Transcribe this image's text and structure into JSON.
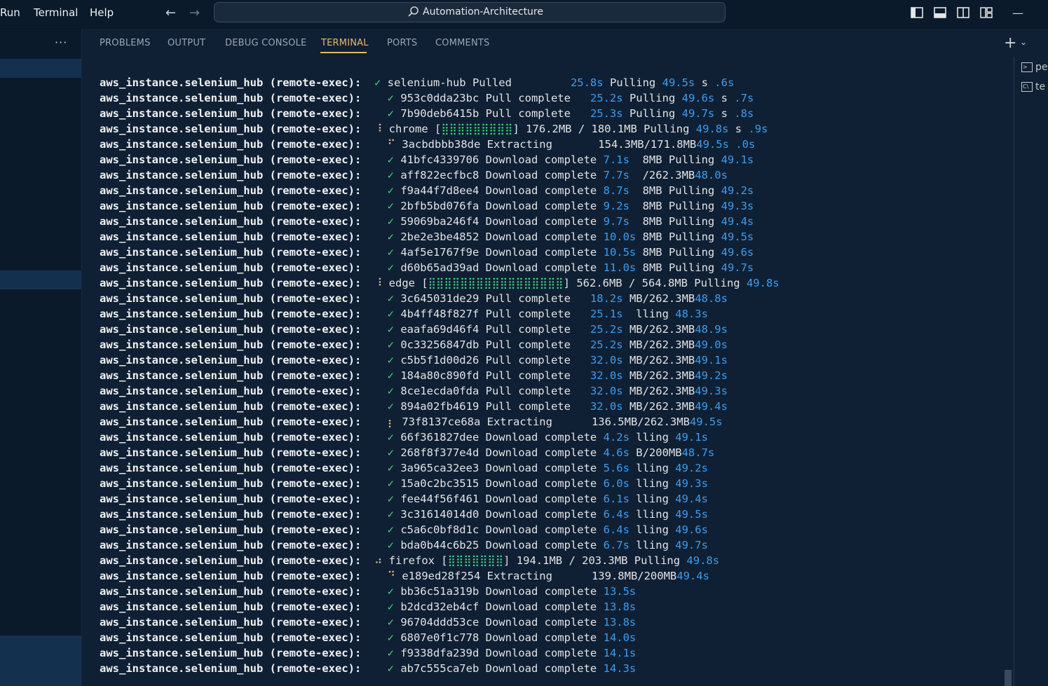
{
  "menu": {
    "run": "Run",
    "terminal": "Terminal",
    "help": "Help"
  },
  "nav": {
    "back": "←",
    "forward": "→"
  },
  "search": {
    "text": "Automation-Architecture"
  },
  "window": {
    "minimize": "—"
  },
  "sidebar": {
    "more": "···"
  },
  "panel_tabs": [
    "PROBLEMS",
    "OUTPUT",
    "DEBUG CONSOLE",
    "TERMINAL",
    "PORTS",
    "COMMENTS"
  ],
  "panel_actions": {
    "new_terminal": "+",
    "dropdown": "⌄"
  },
  "terminal_list": [
    "pe",
    "te"
  ],
  "prefix": "aws_instance.selenium_hub (remote-exec):",
  "lines": [
    {
      "indent": "",
      "mark": "✓",
      "kind": "check",
      "text": "selenium-hub Pulled         ",
      "b1": "25.8s",
      "mid": " Pulling ",
      "b2": "49.5s",
      "tail": " s ",
      "b3": ".6s"
    },
    {
      "indent": "  ",
      "mark": "✓",
      "kind": "check",
      "text": "953c0dda23bc Pull complete   ",
      "b1": "25.2s",
      "mid": " Pulling ",
      "b2": "49.6s",
      "tail": " s ",
      "b3": ".7s"
    },
    {
      "indent": "  ",
      "mark": "✓",
      "kind": "check",
      "text": "7b90deb6415b Pull complete   ",
      "b1": "25.3s",
      "mid": " Pulling ",
      "b2": "49.7s",
      "tail": " s ",
      "b3": ".8s"
    },
    {
      "indent": "",
      "mark": "⠸",
      "kind": "spin",
      "text": "chrome [",
      "bar": "⣿⣿⣿⣿⣿⣿⣿⣿⣿",
      "text2": "] 176.2MB / 180.1MB Pulling ",
      "b2": "49.8s",
      "tail": " s ",
      "b3": ".9s"
    },
    {
      "indent": "  ",
      "mark": "⠋",
      "kind": "spin",
      "text": "3acbdbbb38de Extracting       154.3MB/171.8MB",
      "b2": "49.5s",
      "tail": " ",
      "b3": ".0s"
    },
    {
      "indent": "  ",
      "mark": "✓",
      "kind": "check",
      "text": "41bfc4339706 Download complete ",
      "b1": "7.1s",
      "mid": "  8MB Pulling ",
      "b2": "49.1s"
    },
    {
      "indent": "  ",
      "mark": "✓",
      "kind": "check",
      "text": "aff822ecfbc8 Download complete ",
      "b1": "7.7s",
      "mid": "  /262.3MB",
      "b2": "48.0s"
    },
    {
      "indent": "  ",
      "mark": "✓",
      "kind": "check",
      "text": "f9a44f7d8ee4 Download complete ",
      "b1": "8.7s",
      "mid": "  8MB Pulling ",
      "b2": "49.2s"
    },
    {
      "indent": "  ",
      "mark": "✓",
      "kind": "check",
      "text": "2bfb5bd076fa Download complete ",
      "b1": "9.2s",
      "mid": "  8MB Pulling ",
      "b2": "49.3s"
    },
    {
      "indent": "  ",
      "mark": "✓",
      "kind": "check",
      "text": "59069ba246f4 Download complete ",
      "b1": "9.7s",
      "mid": "  8MB Pulling ",
      "b2": "49.4s"
    },
    {
      "indent": "  ",
      "mark": "✓",
      "kind": "check",
      "text": "2be2e3be4852 Download complete ",
      "b1": "10.0s",
      "mid": " 8MB Pulling ",
      "b2": "49.5s"
    },
    {
      "indent": "  ",
      "mark": "✓",
      "kind": "check",
      "text": "4af5e1767f9e Download complete ",
      "b1": "10.5s",
      "mid": " 8MB Pulling ",
      "b2": "49.6s"
    },
    {
      "indent": "  ",
      "mark": "✓",
      "kind": "check",
      "text": "d60b65ad39ad Download complete ",
      "b1": "11.0s",
      "mid": " 8MB Pulling ",
      "b2": "49.7s"
    },
    {
      "indent": "",
      "mark": "⠸",
      "kind": "spin",
      "text": "edge [",
      "bar": "⣿⣿⣿⣿⣿⣿⣿⣿⣿⣿⣿⣿⣿⣿⣿⣿⣿",
      "text2": "] 562.6MB / 564.8MB Pulling ",
      "b2": "49.8s"
    },
    {
      "indent": "  ",
      "mark": "✓",
      "kind": "check",
      "text": "3c645031de29 Pull complete   ",
      "b1": "18.2s",
      "mid": " MB/262.3MB",
      "b2": "48.8s"
    },
    {
      "indent": "  ",
      "mark": "✓",
      "kind": "check",
      "text": "4b4ff48f827f Pull complete   ",
      "b1": "25.1s",
      "mid": "  lling ",
      "b2": "48.3s"
    },
    {
      "indent": "  ",
      "mark": "✓",
      "kind": "check",
      "text": "eaafa69d46f4 Pull complete   ",
      "b1": "25.2s",
      "mid": " MB/262.3MB",
      "b2": "48.9s"
    },
    {
      "indent": "  ",
      "mark": "✓",
      "kind": "check",
      "text": "0c33256847db Pull complete   ",
      "b1": "25.2s",
      "mid": " MB/262.3MB",
      "b2": "49.0s"
    },
    {
      "indent": "  ",
      "mark": "✓",
      "kind": "check",
      "text": "c5b5f1d00d26 Pull complete   ",
      "b1": "32.0s",
      "mid": " MB/262.3MB",
      "b2": "49.1s"
    },
    {
      "indent": "  ",
      "mark": "✓",
      "kind": "check",
      "text": "184a80c890fd Pull complete   ",
      "b1": "32.0s",
      "mid": " MB/262.3MB",
      "b2": "49.2s"
    },
    {
      "indent": "  ",
      "mark": "✓",
      "kind": "check",
      "text": "8ce1ecda0fda Pull complete   ",
      "b1": "32.0s",
      "mid": " MB/262.3MB",
      "b2": "49.3s"
    },
    {
      "indent": "  ",
      "mark": "✓",
      "kind": "check",
      "text": "894a02fb4619 Pull complete   ",
      "b1": "32.0s",
      "mid": " MB/262.3MB",
      "b2": "49.4s"
    },
    {
      "indent": "  ",
      "mark": "⡆",
      "kind": "spin",
      "text": "73f8137ce68a Extracting      136.5MB/262.3MB",
      "b2": "49.5s"
    },
    {
      "indent": "  ",
      "mark": "✓",
      "kind": "check",
      "text": "66f361827dee Download complete ",
      "b1": "4.2s",
      "mid": " lling ",
      "b2": "49.1s"
    },
    {
      "indent": "  ",
      "mark": "✓",
      "kind": "check",
      "text": "268f8f377e4d Download complete ",
      "b1": "4.6s",
      "mid": " B/200MB",
      "b2": "48.7s"
    },
    {
      "indent": "  ",
      "mark": "✓",
      "kind": "check",
      "text": "3a965ca32ee3 Download complete ",
      "b1": "5.6s",
      "mid": " lling ",
      "b2": "49.2s"
    },
    {
      "indent": "  ",
      "mark": "✓",
      "kind": "check",
      "text": "15a0c2bc3515 Download complete ",
      "b1": "6.0s",
      "mid": " lling ",
      "b2": "49.3s"
    },
    {
      "indent": "  ",
      "mark": "✓",
      "kind": "check",
      "text": "fee44f56f461 Download complete ",
      "b1": "6.1s",
      "mid": " lling ",
      "b2": "49.4s"
    },
    {
      "indent": "  ",
      "mark": "✓",
      "kind": "check",
      "text": "3c31614014d0 Download complete ",
      "b1": "6.4s",
      "mid": " lling ",
      "b2": "49.5s"
    },
    {
      "indent": "  ",
      "mark": "✓",
      "kind": "check",
      "text": "c5a6c0bf8d1c Download complete ",
      "b1": "6.4s",
      "mid": " lling ",
      "b2": "49.6s"
    },
    {
      "indent": "  ",
      "mark": "✓",
      "kind": "check",
      "text": "bda0b44c6b25 Download complete ",
      "b1": "6.7s",
      "mid": " lling ",
      "b2": "49.7s"
    },
    {
      "indent": "",
      "mark": "⠴",
      "kind": "spin",
      "text": "firefox [",
      "bar": "⣿⣿⣿⣿⣿⣿⣿",
      "text2": "] 194.1MB / 203.3MB Pulling ",
      "b2": "49.8s"
    },
    {
      "indent": "  ",
      "mark": "⠙",
      "kind": "spin",
      "text": "e189ed28f254 Extracting      139.8MB/200MB",
      "b2": "49.4s"
    },
    {
      "indent": "  ",
      "mark": "✓",
      "kind": "check",
      "text": "bb36c51a319b Download complete ",
      "b1": "13.5s"
    },
    {
      "indent": "  ",
      "mark": "✓",
      "kind": "check",
      "text": "b2dcd32eb4cf Download complete ",
      "b1": "13.8s"
    },
    {
      "indent": "  ",
      "mark": "✓",
      "kind": "check",
      "text": "96704ddd53ce Download complete ",
      "b1": "13.8s"
    },
    {
      "indent": "  ",
      "mark": "✓",
      "kind": "check",
      "text": "6807e0f1c778 Download complete ",
      "b1": "14.0s"
    },
    {
      "indent": "  ",
      "mark": "✓",
      "kind": "check",
      "text": "f9338dfa239d Download complete ",
      "b1": "14.1s"
    },
    {
      "indent": "  ",
      "mark": "✓",
      "kind": "check",
      "text": "ab7c555ca7eb Download complete ",
      "b1": "14.3s"
    }
  ],
  "colors": {
    "accent": "#e8b86b",
    "success": "#3fd67a",
    "time": "#3b9cf0",
    "spinner": "#e5c07b",
    "background": "#0f2034"
  }
}
